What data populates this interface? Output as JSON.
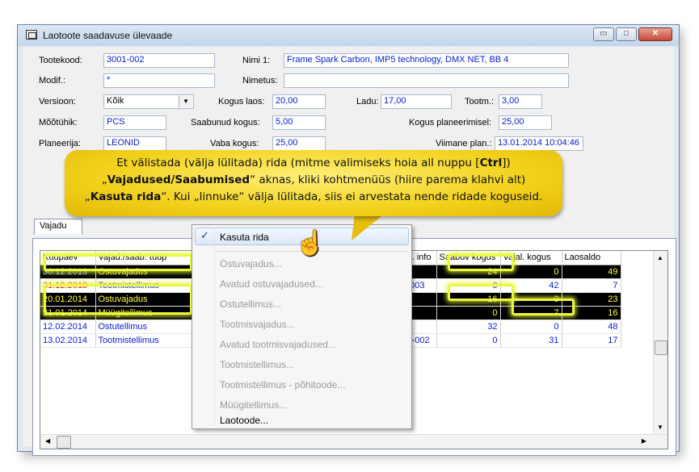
{
  "window": {
    "title": "Laotoote saadavuse ülevaade",
    "buttons": {
      "minimize": "▭",
      "maximize": "□",
      "close": "✕"
    }
  },
  "form": {
    "tootekood": {
      "label": "Tootekood:",
      "value": "3001-002"
    },
    "nimi1": {
      "label": "Nimi 1:",
      "value": "Frame Spark Carbon, IMP5 technology, DMX NET, BB 4"
    },
    "modif": {
      "label": "Modif.:",
      "value": "*"
    },
    "nimetus": {
      "label": "Nimetus:",
      "value": ""
    },
    "versioon": {
      "label": "Versioon:",
      "value": "Kõik"
    },
    "kogus_laos": {
      "label": "Kogus laos:",
      "value": "20,00"
    },
    "ladu": {
      "label": "Ladu:",
      "value": "17,00"
    },
    "tootm": {
      "label": "Tootm.:",
      "value": "3,00"
    },
    "mootuhik": {
      "label": "Mõõtühik:",
      "value": "PCS"
    },
    "saabunud_kogus": {
      "label": "Saabunud kogus:",
      "value": "5,00"
    },
    "kogus_planeerimisel": {
      "label": "Kogus planeerimisel:",
      "value": "25,00"
    },
    "planeerija": {
      "label": "Planeerija:",
      "value": "LEONID"
    },
    "vaba_kogus": {
      "label": "Vaba kogus:",
      "value": "25,00"
    },
    "viimane_plan": {
      "label": "Viimane plan.:",
      "value": "13.01.2014 10:04:46"
    }
  },
  "tabs": [
    {
      "label": "Vajadu"
    }
  ],
  "grid": {
    "headers": [
      "Kuupäev",
      "Vajad./saab. tüüp",
      "",
      "d. info",
      "Saabuv kogus",
      "Vajal. kogus",
      "Laosaldo"
    ],
    "rows": [
      {
        "date": "30.12.2013",
        "type": "Ostuvajadus",
        "info": "",
        "incoming": "24",
        "needed": "0",
        "balance": "49",
        "style": "dark",
        "date_color": "#8fb9ff",
        "type_color": "#ffff3c"
      },
      {
        "date": "31.12.2013",
        "type": "Tootmistellimus",
        "info": "-003",
        "incoming": "0",
        "needed": "42",
        "balance": "7",
        "style": "light",
        "date_color": "#e02020",
        "type_color": "#1020d0"
      },
      {
        "date": "20.01.2014",
        "type": "Ostuvajadus",
        "info": "",
        "incoming": "16",
        "needed": "0",
        "balance": "23",
        "style": "dark",
        "date_color": "#ffff3c",
        "type_color": "#ffff3c"
      },
      {
        "date": "21.01.2014",
        "type": "Müügitellimus",
        "info": "",
        "incoming": "0",
        "needed": "7",
        "balance": "16",
        "style": "dark",
        "date_color": "#ffff3c",
        "type_color": "#ffff3c"
      },
      {
        "date": "12.02.2014",
        "type": "Ostutellimus",
        "info": "",
        "incoming": "32",
        "needed": "0",
        "balance": "48",
        "style": "light",
        "date_color": "#1020d0",
        "type_color": "#1020d0"
      },
      {
        "date": "13.02.2014",
        "type": "Tootmistellimus",
        "info": "2-002",
        "incoming": "0",
        "needed": "31",
        "balance": "17",
        "style": "light",
        "date_color": "#1020d0",
        "type_color": "#1020d0"
      }
    ]
  },
  "context_menu": {
    "check": "✓",
    "items": [
      {
        "label": "Kasuta rida",
        "enabled": true
      },
      {
        "label": "Ostuvajadus...",
        "enabled": false
      },
      {
        "label": "Avatud ostuvajadused...",
        "enabled": false
      },
      {
        "label": "Ostutellimus...",
        "enabled": false
      },
      {
        "label": "Tootmisvajadus...",
        "enabled": false
      },
      {
        "label": "Avatud tootmisvajadused...",
        "enabled": false
      },
      {
        "label": "Tootmistellimus...",
        "enabled": false
      },
      {
        "label": "Tootmistellimus - põhitoode...",
        "enabled": false
      },
      {
        "label": "Müügitellimus...",
        "enabled": false
      },
      {
        "label": "Laotoode...",
        "enabled": true
      }
    ]
  },
  "callout": {
    "line1_a": "Et välistada (välja lülitada) rida (mitme valimiseks hoia all nuppu [",
    "line1_b": "Ctrl",
    "line1_c": "])",
    "line2_a": "„",
    "line2_b": "Vajadused/Saabumised",
    "line2_c": "“ aknas, kliki kohtmenüüs (hiire parema klahvi alt)",
    "line3_a": "„",
    "line3_b": "Kasuta rida",
    "line3_c": "“. Kui „linnuke“ välja lülitada, siis ei arvestata nende ridade koguseid."
  },
  "colors": {
    "highlight": "#eaf83a",
    "callout": "#f2d21c",
    "field_text": "#0b21c9"
  }
}
